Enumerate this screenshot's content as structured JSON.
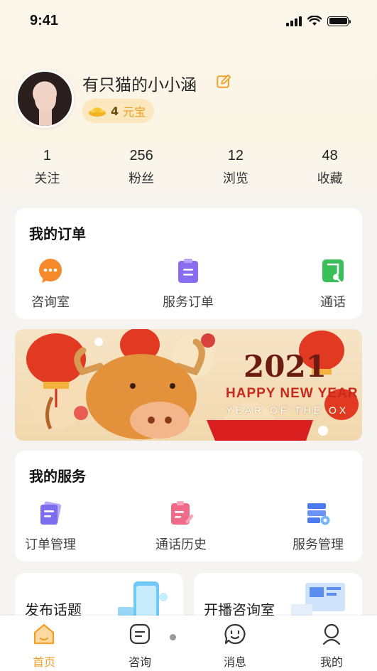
{
  "status": {
    "time": "9:41"
  },
  "profile": {
    "username": "有只猫的小小涵",
    "coins": "4",
    "coin_unit": "元宝"
  },
  "stats": [
    {
      "value": "1",
      "label": "关注"
    },
    {
      "value": "256",
      "label": "粉丝"
    },
    {
      "value": "12",
      "label": "浏览"
    },
    {
      "value": "48",
      "label": "收藏"
    }
  ],
  "orders": {
    "title": "我的订单",
    "items": [
      {
        "label": "咨询室",
        "icon": "chat-bubble-icon",
        "color": "#f58a2b"
      },
      {
        "label": "服务订单",
        "icon": "clipboard-icon",
        "color": "#8a6cf0"
      },
      {
        "label": "通话",
        "icon": "phone-record-icon",
        "color": "#3bbf5a"
      }
    ]
  },
  "banner": {
    "year": "2021",
    "greeting": "HAPPY NEW YEAR",
    "subtitle": "YEAR OF THE OX"
  },
  "services": {
    "title": "我的服务",
    "items": [
      {
        "label": "订单管理",
        "icon": "order-manage-icon",
        "color": "#7b6cf0"
      },
      {
        "label": "通话历史",
        "icon": "call-history-icon",
        "color": "#f06a8a"
      },
      {
        "label": "服务管理",
        "icon": "service-manage-icon",
        "color": "#4a7cf0"
      }
    ]
  },
  "promo": {
    "left": "发布话题",
    "right": "开播咨询室"
  },
  "tabbar": {
    "active_color": "#f0a126",
    "items": [
      {
        "label": "首页",
        "icon": "home-icon"
      },
      {
        "label": "咨询",
        "icon": "consult-icon"
      },
      {
        "label": "消息",
        "icon": "message-icon"
      },
      {
        "label": "我的",
        "icon": "profile-icon"
      }
    ]
  }
}
